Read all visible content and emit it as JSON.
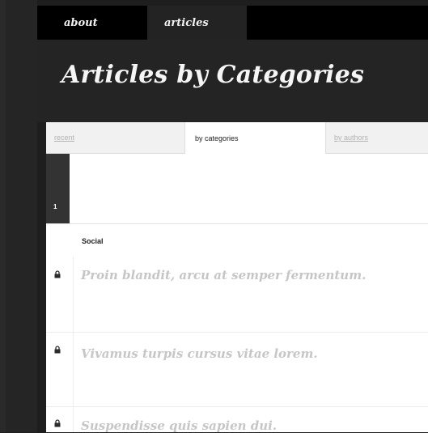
{
  "nav": {
    "about": "about",
    "articles": "articles"
  },
  "header": {
    "title": "Articles by Categories"
  },
  "subtabs": {
    "recent": "recent",
    "by_categories": "by categories",
    "by_authors": "by authors"
  },
  "pagination": {
    "current_page": "1"
  },
  "category": {
    "name": "Social"
  },
  "articles": [
    {
      "title": "Proin blandit, arcu at semper fermentum.",
      "icon": "lock-icon"
    },
    {
      "title": "Vivamus turpis cursus vitae lorem.",
      "icon": "lock-icon"
    },
    {
      "title": "Suspendisse quis sapien dui.",
      "icon": "lock-icon"
    }
  ]
}
